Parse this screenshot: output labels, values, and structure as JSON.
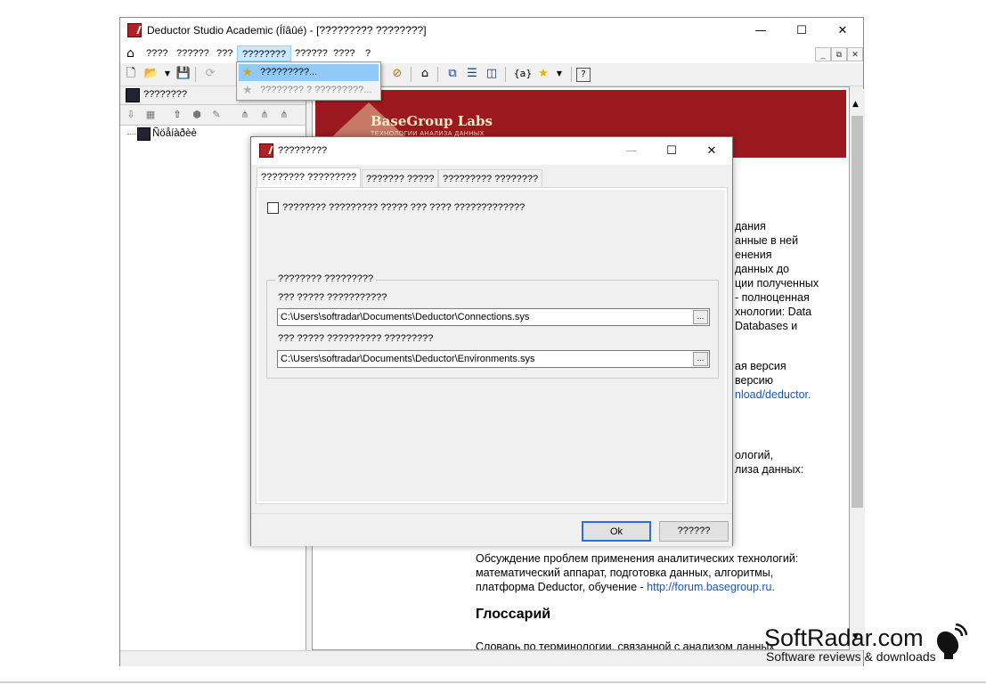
{
  "window": {
    "title": "Deductor Studio Academic (Íîâûé) - [????????? ????????]",
    "minimize_glyph": "—",
    "maximize_glyph": "☐",
    "close_glyph": "✕"
  },
  "menubar": {
    "items": [
      "????",
      "??????",
      "???",
      "????????",
      "??????",
      "????",
      "?"
    ],
    "active_index": 3,
    "mdi_buttons": [
      "_",
      "⧉",
      "✕"
    ]
  },
  "menu_dropdown": {
    "items": [
      {
        "label": "?????????...",
        "enabled": true,
        "icon": "star-icon"
      },
      {
        "label": "???????? ? ?????????...",
        "enabled": false,
        "icon": "star-icon"
      }
    ]
  },
  "left_pane": {
    "title": "????????",
    "tree_root": "Ñöåíàðèè"
  },
  "banner": {
    "brand": "BaseGroup  Labs",
    "tagline": "ТЕХНОЛОГИИ АНАЛИЗА ДАННЫХ"
  },
  "right_content": {
    "lines_block1": [
      "дания",
      "анные в ней",
      "енения",
      "данных до",
      "ции полученных",
      "- полноценная",
      "хнологии: Data",
      "Databases и"
    ],
    "lines_block2": [
      "ая версия",
      "версию"
    ],
    "link_block2": "nload/deductor.",
    "lines_block3": [
      "ологий,",
      "лиза данных:"
    ],
    "forum_text": [
      "Обсуждение проблем применения аналитических технологий:",
      "математический аппарат, подготовка данных, алгоритмы,"
    ],
    "forum_last_prefix": "платформа Deductor, обучение - ",
    "forum_link": "http://forum.basegroup.ru.",
    "glossary_title": "Глоссарий",
    "glossary_text": "Словарь по терминологии, связанной с анализом данных"
  },
  "dialog": {
    "title": "?????????",
    "tabs": [
      "???????? ?????????",
      "??????? ?????",
      "????????? ????????"
    ],
    "selected_tab": 0,
    "checkbox_label": "???????? ????????? ????? ??? ???? ?????????????",
    "checkbox_checked": false,
    "group_title": "???????? ?????????",
    "field1_label": "??? ????? ???????????",
    "field1_value": "C:\\Users\\softradar\\Documents\\Deductor\\Connections.sys",
    "field2_label": "??? ????? ?????????? ?????????",
    "field2_value": "C:\\Users\\softradar\\Documents\\Deductor\\Environments.sys",
    "browse_label": "...",
    "ok_label": "Ok",
    "cancel_label": "??????"
  },
  "watermark": {
    "title": "SoftRadar.com",
    "subtitle": "Software reviews & downloads"
  },
  "colors": {
    "banner_red": "#9c1a1f",
    "link_blue": "#1e56a8",
    "menu_highlight": "#cce8ff",
    "ok_border": "#2f6fcf"
  }
}
